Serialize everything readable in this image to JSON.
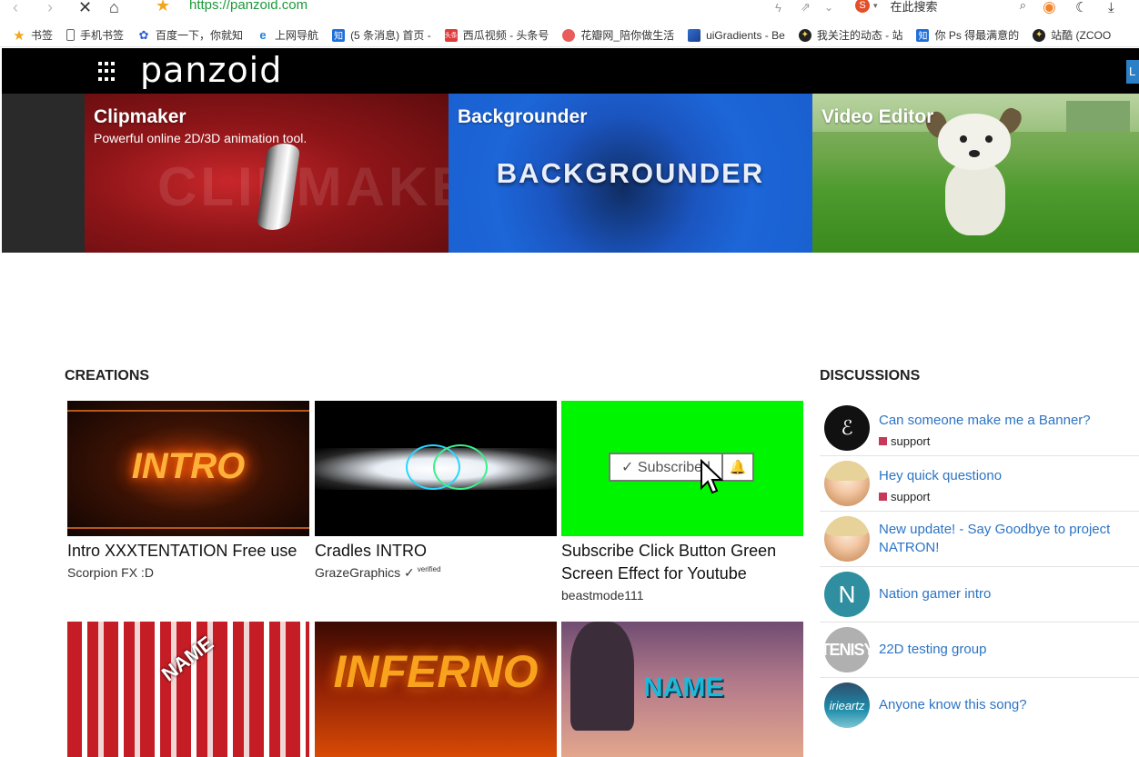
{
  "browser": {
    "url": "https://panzoid.com",
    "search_placeholder": "在此搜索",
    "search_logo": "S",
    "bookmarks": [
      {
        "label": "书签",
        "icon": "star-icon",
        "color": "#f4a51c"
      },
      {
        "label": "手机书签",
        "icon": "phone-icon",
        "color": "#666666"
      },
      {
        "label": "百度一下，你就知",
        "icon": "baidu-icon",
        "color": "#2e5fd6"
      },
      {
        "label": "上网导航",
        "icon": "ie-icon",
        "color": "#1f7fd8"
      },
      {
        "label": "(5 条消息) 首页 -",
        "icon": "zhihu-icon",
        "color": "#1e6fd9"
      },
      {
        "label": "西瓜视频 - 头条号",
        "icon": "toutiao-icon",
        "color": "#e03b3b"
      },
      {
        "label": "花瓣网_陪你做生活",
        "icon": "huaban-icon",
        "color": "#e85c5c"
      },
      {
        "label": "uiGradients - Be",
        "icon": "uigradients-icon",
        "color": "#2f6fcf"
      },
      {
        "label": "我关注的动态 - 站",
        "icon": "zcool-icon",
        "color": "#222222"
      },
      {
        "label": "你 Ps 得最满意的",
        "icon": "zhihu-icon",
        "color": "#1e6fd9"
      },
      {
        "label": "站酷 (ZCOO",
        "icon": "zcool-icon",
        "color": "#222222"
      }
    ]
  },
  "header": {
    "logo": "panzoid",
    "login_label": "L"
  },
  "hero": [
    {
      "title": "Clipmaker",
      "subtitle": "Powerful online 2D/3D animation tool.",
      "watermark": "CLIPMAKER"
    },
    {
      "title": "Backgrounder",
      "subtitle": "",
      "overlay": "BACKGROUNDER"
    },
    {
      "title": "Video Editor",
      "subtitle": ""
    }
  ],
  "creations": {
    "heading": "CREATIONS",
    "items": [
      {
        "title": "Intro XXXTENTATION Free use",
        "author": "Scorpion FX :D",
        "thumb_text": "INTRO",
        "verified": ""
      },
      {
        "title": "Cradles INTRO",
        "author": "GrazeGraphics ✓",
        "thumb_text": "",
        "verified": "verified"
      },
      {
        "title": "Subscribe Click Button Green Screen Effect for Youtube",
        "author": "beastmode111",
        "thumb_text": "✓ Subscribed",
        "verified": ""
      },
      {
        "title": "",
        "author": "",
        "thumb_text": "NAME",
        "verified": ""
      },
      {
        "title": "",
        "author": "",
        "thumb_text": "INFERNO",
        "verified": ""
      },
      {
        "title": "",
        "author": "",
        "thumb_text": "NAME",
        "verified": ""
      }
    ]
  },
  "discussions": {
    "heading": "DISCUSSIONS",
    "items": [
      {
        "title": "Can someone make me a Banner?",
        "tag": "support",
        "avatar_text": "ℰ"
      },
      {
        "title": "Hey quick questiono",
        "tag": "support",
        "avatar_text": ""
      },
      {
        "title": "New update! - Say Goodbye to project NATRON!",
        "tag": "",
        "avatar_text": ""
      },
      {
        "title": "Nation gamer intro",
        "tag": "",
        "avatar_text": "N"
      },
      {
        "title": "22D testing group",
        "tag": "",
        "avatar_text": "TENISY"
      },
      {
        "title": "Anyone know this song?",
        "tag": "",
        "avatar_text": "irieartz"
      }
    ]
  }
}
